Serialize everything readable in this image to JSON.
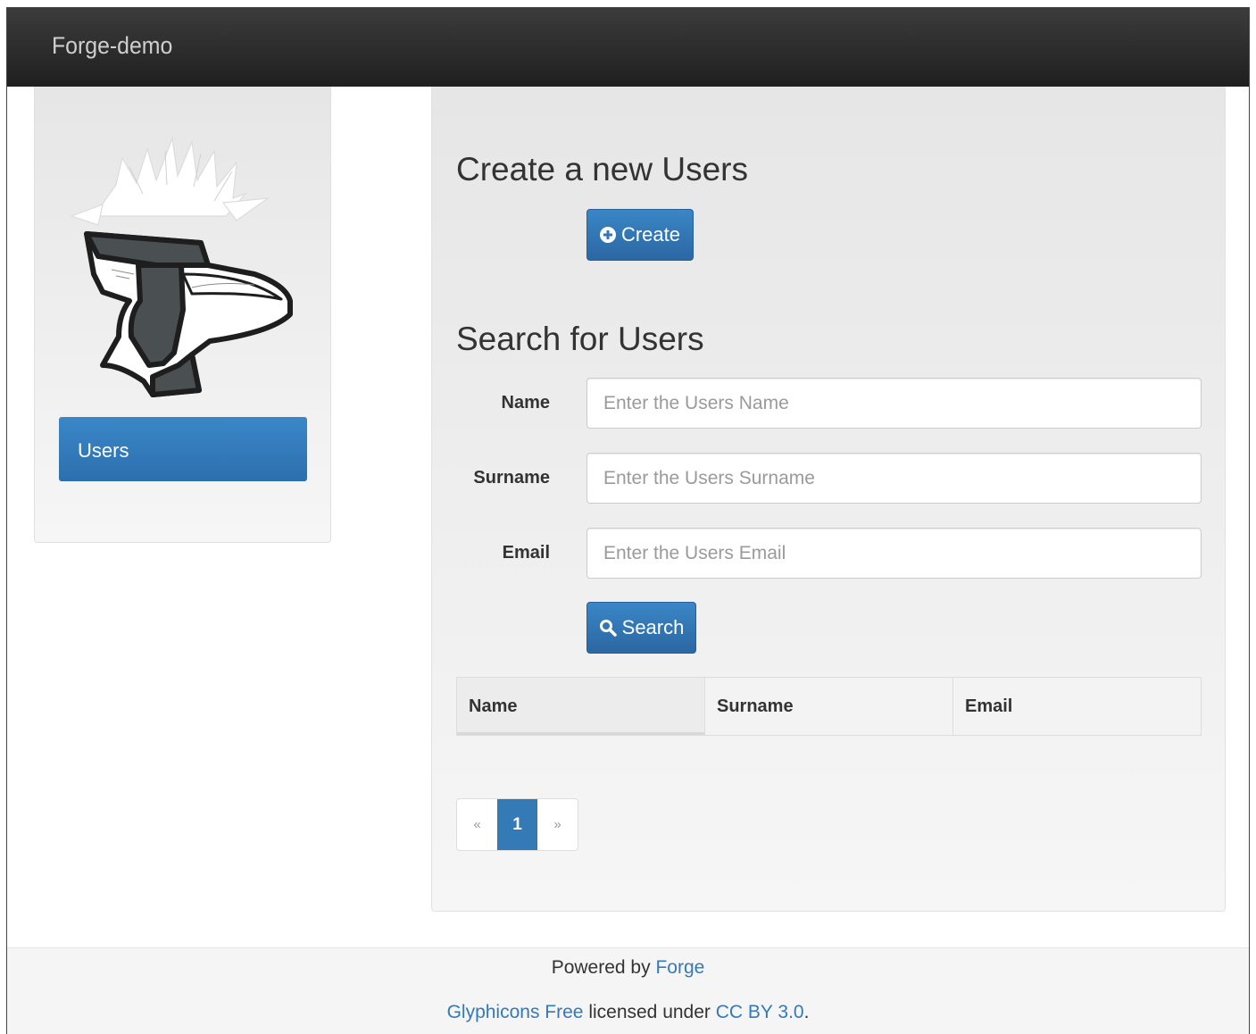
{
  "navbar": {
    "brand": "Forge-demo"
  },
  "sidebar": {
    "items": [
      {
        "label": "Users",
        "active": true
      }
    ]
  },
  "create_section": {
    "heading": "Create a new Users",
    "create_button": {
      "label": "Create",
      "icon": "plus-sign-icon"
    }
  },
  "search_section": {
    "heading": "Search for Users",
    "fields": [
      {
        "label": "Name",
        "placeholder": "Enter the Users Name",
        "value": ""
      },
      {
        "label": "Surname",
        "placeholder": "Enter the Users Surname",
        "value": ""
      },
      {
        "label": "Email",
        "placeholder": "Enter the Users Email",
        "value": ""
      }
    ],
    "search_button": {
      "label": "Search",
      "icon": "search-icon"
    }
  },
  "results_table": {
    "columns": [
      "Name",
      "Surname",
      "Email"
    ],
    "rows": []
  },
  "pagination": {
    "prev": "«",
    "pages": [
      "1"
    ],
    "current": "1",
    "next": "»"
  },
  "footer": {
    "powered_by_text": "Powered by",
    "powered_by_link": "Forge",
    "glyphicons_link": "Glyphicons Free",
    "licensed_text": "licensed under",
    "license_link": "CC BY 3.0",
    "period": "."
  },
  "colors": {
    "primary": "#337ab7",
    "navbar": "#222222",
    "panel": "#f0f0f0"
  }
}
